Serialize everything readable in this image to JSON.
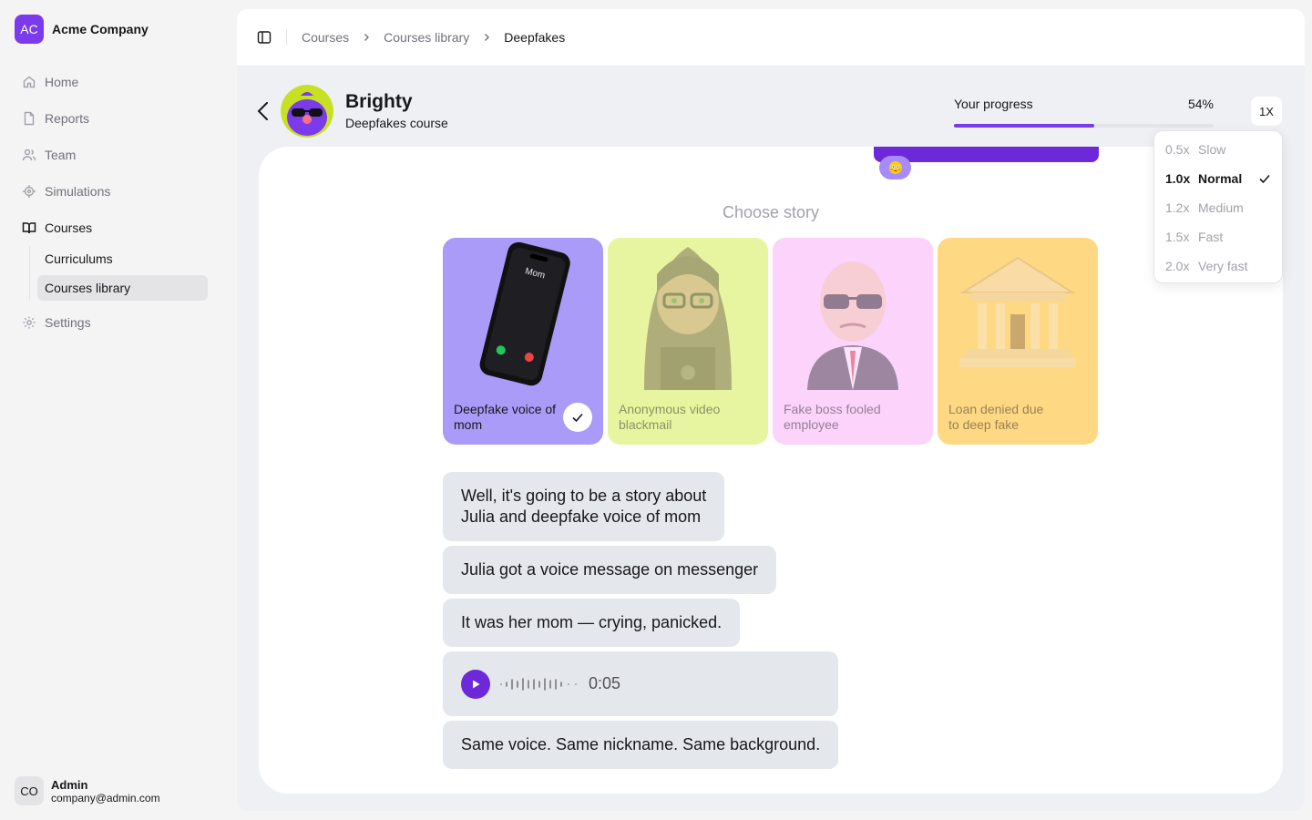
{
  "company": {
    "initials": "AC",
    "name": "Acme Company"
  },
  "nav": {
    "home": "Home",
    "reports": "Reports",
    "team": "Team",
    "simulations": "Simulations",
    "courses": "Courses",
    "curriculums": "Curriculums",
    "courses_library": "Courses library",
    "settings": "Settings"
  },
  "user": {
    "initials": "CO",
    "name": "Admin",
    "email": "company@admin.com"
  },
  "breadcrumb": [
    "Courses",
    "Courses library",
    "Deepfakes"
  ],
  "course": {
    "title": "Brighty",
    "subtitle": "Deepfakes course"
  },
  "progress": {
    "label": "Your progress",
    "percent_text": "54%",
    "value": 0.54
  },
  "speed": {
    "button_label": "1X",
    "options": [
      {
        "rate": "0.5x",
        "name": "Slow",
        "selected": false
      },
      {
        "rate": "1.0x",
        "name": "Normal",
        "selected": true
      },
      {
        "rate": "1.2x",
        "name": "Medium",
        "selected": false
      },
      {
        "rate": "1.5x",
        "name": "Fast",
        "selected": false
      },
      {
        "rate": "2.0x",
        "name": "Very fast",
        "selected": false
      }
    ]
  },
  "choose_title": "Choose story",
  "stories": [
    {
      "label": "Deepfake voice of mom",
      "bg": "#a99bf7",
      "selected": true,
      "phone_text": "Mom"
    },
    {
      "label": "Anonymous video blackmail",
      "bg": "#e8f5a0",
      "selected": false
    },
    {
      "label": "Fake boss fooled employee",
      "bg": "#fbd3fb",
      "selected": false
    },
    {
      "label": "Loan denied due to deep fake",
      "bg": "#ffd884",
      "selected": false
    }
  ],
  "messages": [
    "Well, it's going to be a story about\nJulia and deepfake voice of mom",
    "Julia got a voice message on messenger",
    "It was her mom — crying, panicked.",
    "Same voice. Same nickname. Same background."
  ],
  "voice_message": {
    "duration": "0:05"
  },
  "colors": {
    "accent": "#6d28d9",
    "progress": "#7c3aed"
  }
}
